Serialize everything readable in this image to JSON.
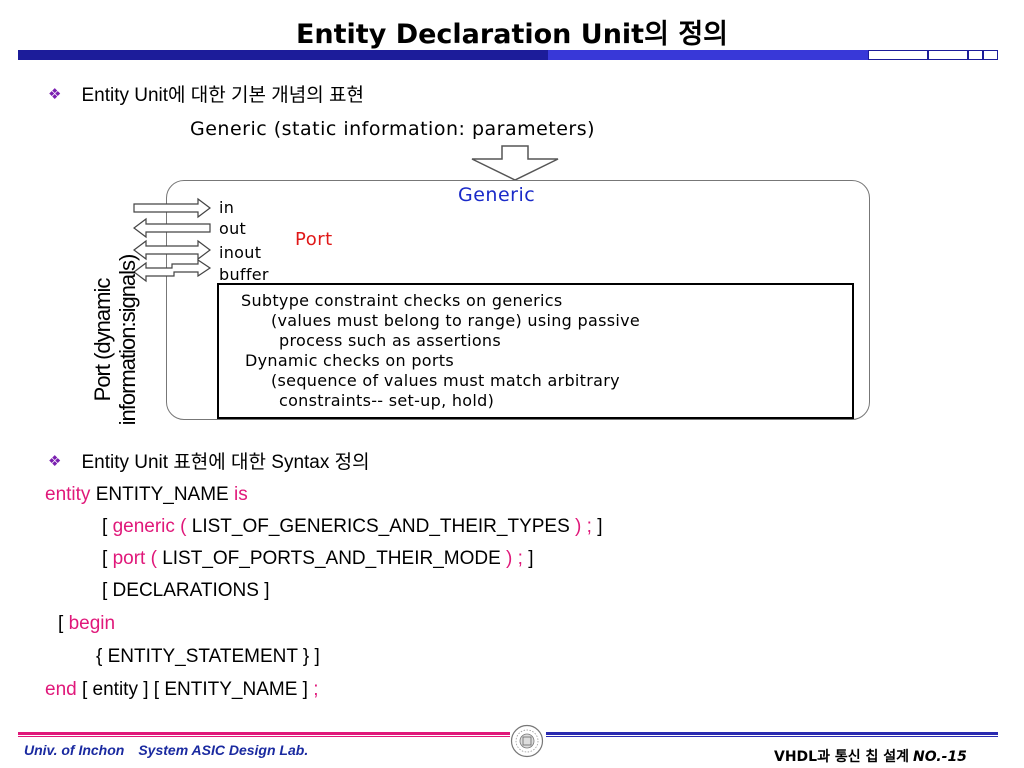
{
  "title": "Entity Declaration Unit의 정의",
  "colors": {
    "bullet": "#7a1fb0",
    "keyword": "#e0187a",
    "generic": "#1a2ac8",
    "port": "#e01818",
    "footer_text": "#1a2aa0"
  },
  "icons": {
    "bullet": "four-diamond-bullet-icon",
    "seal": "university-seal-icon"
  },
  "bullet1": {
    "text": "Entity Unit에 대한 기본 개념의 표현"
  },
  "diagram": {
    "top_caption": "Generic (static information: parameters)",
    "generic_label": "Generic",
    "port_label": "Port",
    "port_modes": [
      "in",
      "out",
      "inout",
      "buffer"
    ],
    "side_label_line1": "Port (dynamic",
    "side_label_line2": "information:signals)",
    "checks": [
      "Subtype constraint checks on generics",
      "(values must belong to range) using passive",
      "process such as assertions",
      "Dynamic checks on ports",
      "(sequence of values must match arbitrary",
      "constraints-- set-up, hold)"
    ]
  },
  "bullet2": {
    "text": "Entity Unit 표현에 대한 Syntax 정의"
  },
  "syntax": {
    "line1": {
      "kw1": "entity",
      "name": " ENTITY_NAME ",
      "kw2": "is"
    },
    "line2": {
      "open": "[ ",
      "kw1": "generic (",
      "body": " LIST_OF_GENERICS_AND_THEIR_TYPES ",
      "kw2": ") ;",
      "close": " ]"
    },
    "line3": {
      "open": "[ ",
      "kw1": "port (",
      "body": " LIST_OF_PORTS_AND_THEIR_MODE ",
      "kw2": ") ;",
      "close": " ]"
    },
    "line4": {
      "text": "[ DECLARATIONS ]"
    },
    "line5": {
      "open": "[ ",
      "kw": "begin"
    },
    "line6": {
      "text": "{ ENTITY_STATEMENT } ]"
    },
    "line7": {
      "kw1": "end",
      "body": " [ entity ] [ ENTITY_NAME ] ",
      "kw2": ";"
    }
  },
  "footer": {
    "univ": "Univ. of Inchon",
    "lab": "System ASIC Design Lab.",
    "course": "VHDL과 통신 칩 설계",
    "page": "NO.-15"
  }
}
